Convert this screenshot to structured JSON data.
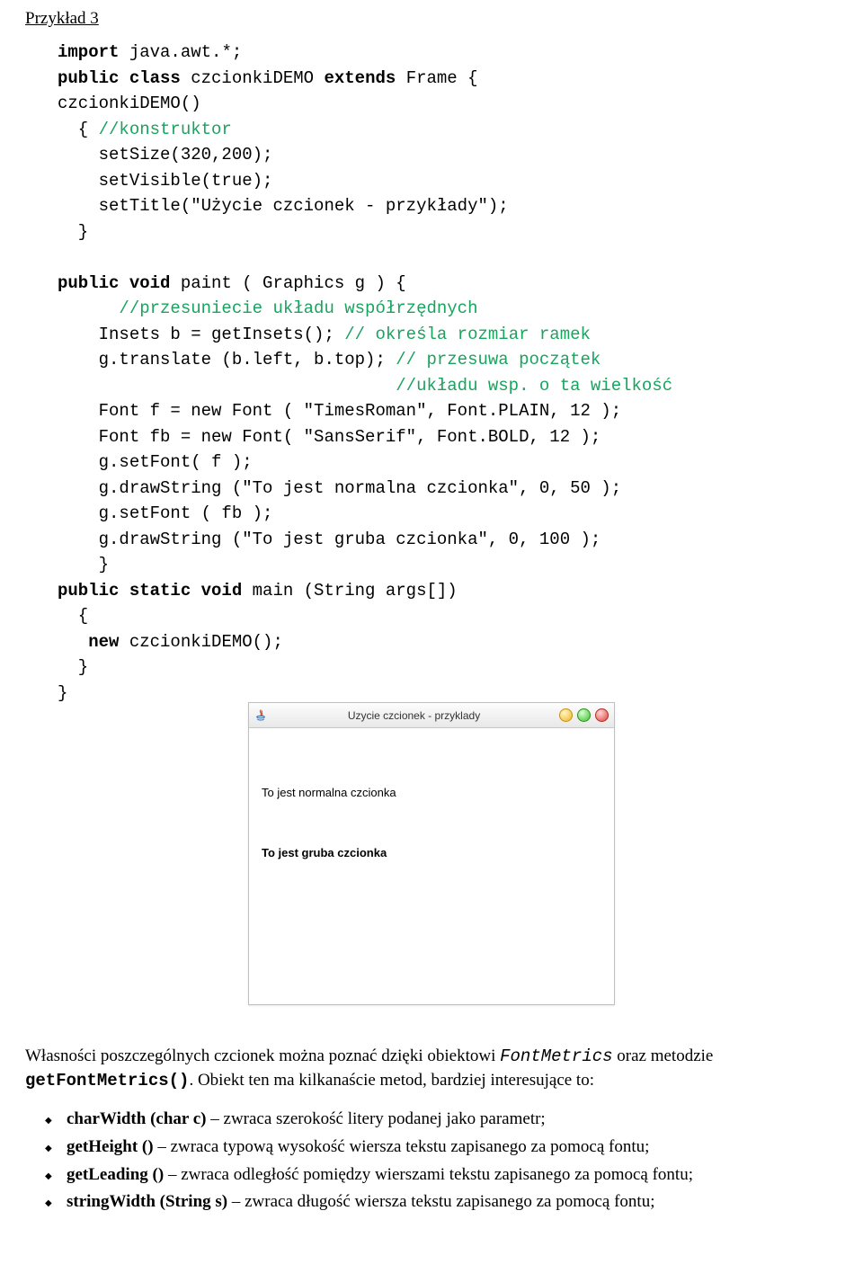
{
  "heading": "Przykład 3",
  "code": {
    "l01_kw1": "import",
    "l01_t": " java.awt.*;",
    "l02_kw1": "public class",
    "l02_t1": " czcionkiDEMO ",
    "l02_kw2": "extends",
    "l02_t2": " Frame {",
    "l03": "czcionkiDEMO()",
    "l04_t": "  { ",
    "l04_c": "//konstruktor",
    "l05": "    setSize(320,200);",
    "l06": "    setVisible(true);",
    "l07": "    setTitle(\"Użycie czcionek - przykłady\");",
    "l08": "  }",
    "l10_kw1": "public void",
    "l10_t": " paint ( Graphics g ) {",
    "l11_c": "      //przesuniecie układu współrzędnych",
    "l12_t": "    Insets b = getInsets(); ",
    "l12_c": "// określa rozmiar ramek",
    "l13_t": "    g.translate (b.left, b.top); ",
    "l13_c": "// przesuwa początek",
    "l13b_c": "                                 //układu wsp. o ta wielkość",
    "l14": "    Font f = new Font ( \"TimesRoman\", Font.PLAIN, 12 );",
    "l15": "    Font fb = new Font( \"SansSerif\", Font.BOLD, 12 );",
    "l16": "    g.setFont( f );",
    "l17": "    g.drawString (\"To jest normalna czcionka\", 0, 50 );",
    "l18": "    g.setFont ( fb );",
    "l19": "    g.drawString (\"To jest gruba czcionka\", 0, 100 );",
    "l20": "    }",
    "l21_kw1": "public static void",
    "l21_t": " main (String args[])",
    "l22": "  {",
    "l23_kw": "   new",
    "l23_t": " czcionkiDEMO();",
    "l24": "  }",
    "l25": "}"
  },
  "window": {
    "title": "Uzycie czcionek - przyklady",
    "normal_text": "To jest normalna czcionka",
    "bold_text": "To jest gruba czcionka"
  },
  "paragraph": {
    "p1a": "Własności poszczególnych czcionek można poznać dzięki obiektowi ",
    "p1obj": "FontMetrics",
    "p1b": " oraz metodzie ",
    "p1meth": "getFontMetrics()",
    "p1c": ". Obiekt ten ma kilkanaście metod, bardziej interesujące to:"
  },
  "methods": [
    {
      "name": "charWidth (char c)",
      "desc": " – zwraca szerokość litery podanej jako parametr;"
    },
    {
      "name": "getHeight ()",
      "desc": " – zwraca typową wysokość wiersza tekstu zapisanego za pomocą fontu;"
    },
    {
      "name": "getLeading ()",
      "desc": " – zwraca odległość pomiędzy wierszami tekstu  zapisanego za pomocą fontu;"
    },
    {
      "name": "stringWidth (String s)",
      "desc": " – zwraca długość wiersza tekstu zapisanego za pomocą fontu;"
    }
  ]
}
